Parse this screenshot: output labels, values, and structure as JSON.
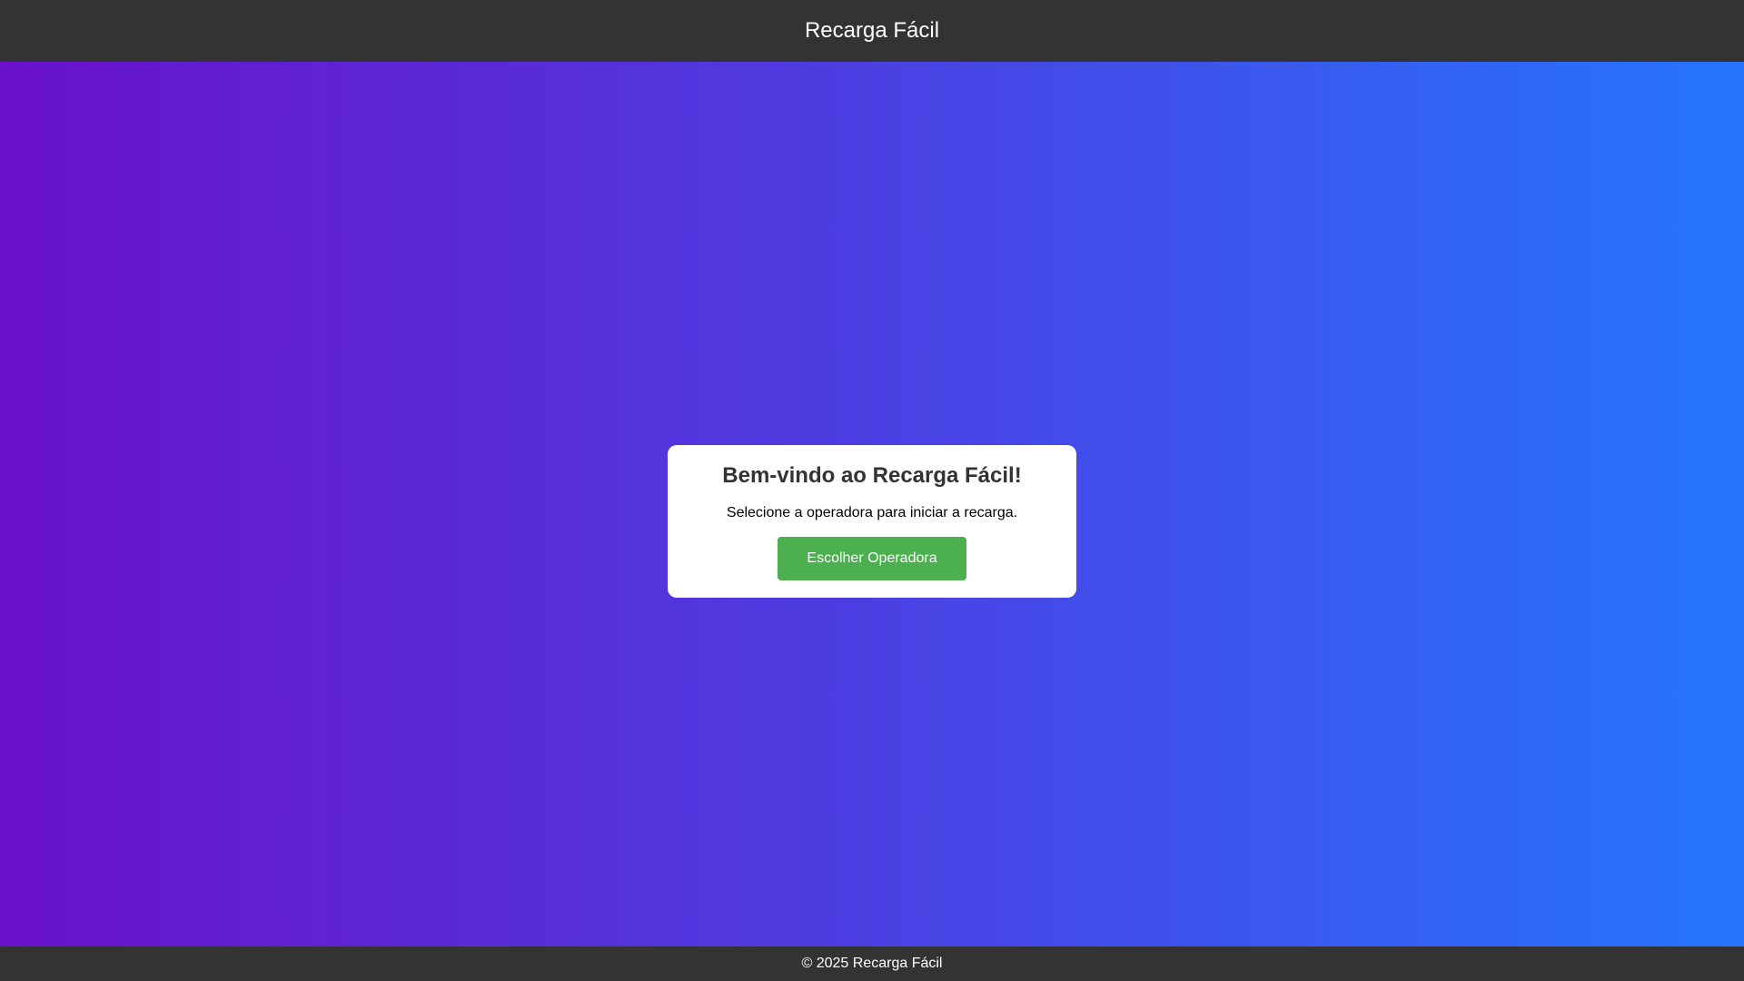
{
  "header": {
    "title": "Recarga Fácil"
  },
  "welcome_card": {
    "heading": "Bem-vindo ao Recarga Fácil!",
    "subtext": "Selecione a operadora para iniciar a recarga.",
    "button_label": "Escolher Operadora"
  },
  "footer": {
    "text": "© 2025 Recarga Fácil"
  },
  "colors": {
    "header_bg": "#333333",
    "gradient_start": "#6a11cb",
    "gradient_end": "#2575fc",
    "button_bg": "#4caf50",
    "card_bg": "#ffffff"
  }
}
